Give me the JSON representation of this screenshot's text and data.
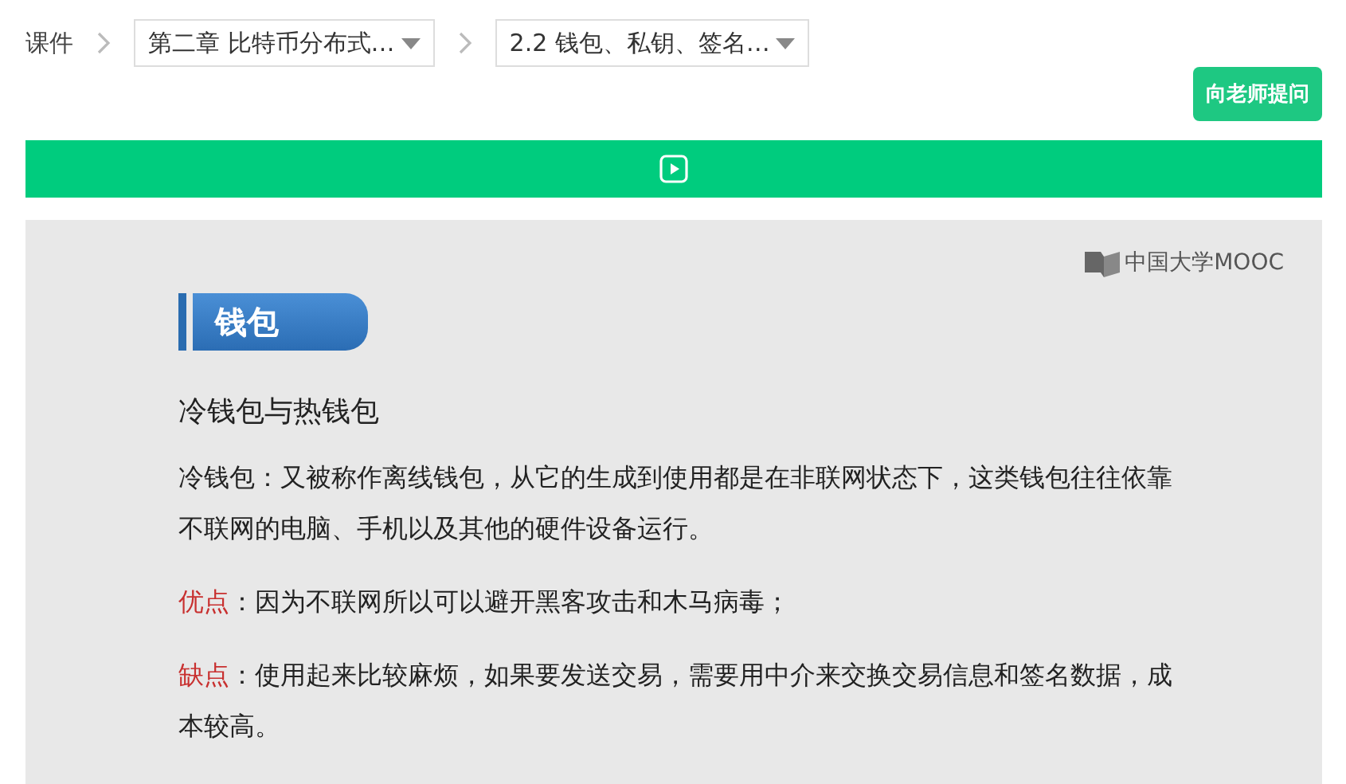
{
  "breadcrumb": {
    "root": "课件",
    "chapter": {
      "label": "第二章 比特币分布式…"
    },
    "section": {
      "label": "2.2 钱包、私钥、签名…"
    }
  },
  "ask_button": "向老师提问",
  "slide": {
    "logo": "中国大学MOOC",
    "heading": "钱包",
    "subtitle": "冷钱包与热钱包",
    "paragraphs": [
      {
        "kind": "plain",
        "text": "冷钱包：又被称作离线钱包，从它的生成到使用都是在非联网状态下，这类钱包往往依靠不联网的电脑、手机以及其他的硬件设备运行。"
      },
      {
        "kind": "labelled",
        "label": "优点",
        "text": "：因为不联网所以可以避开黑客攻击和木马病毒；"
      },
      {
        "kind": "labelled",
        "label": "缺点",
        "text": "：使用起来比较麻烦，如果要发送交易，需要用中介来交换交易信息和签名数据，成本较高。"
      }
    ]
  }
}
